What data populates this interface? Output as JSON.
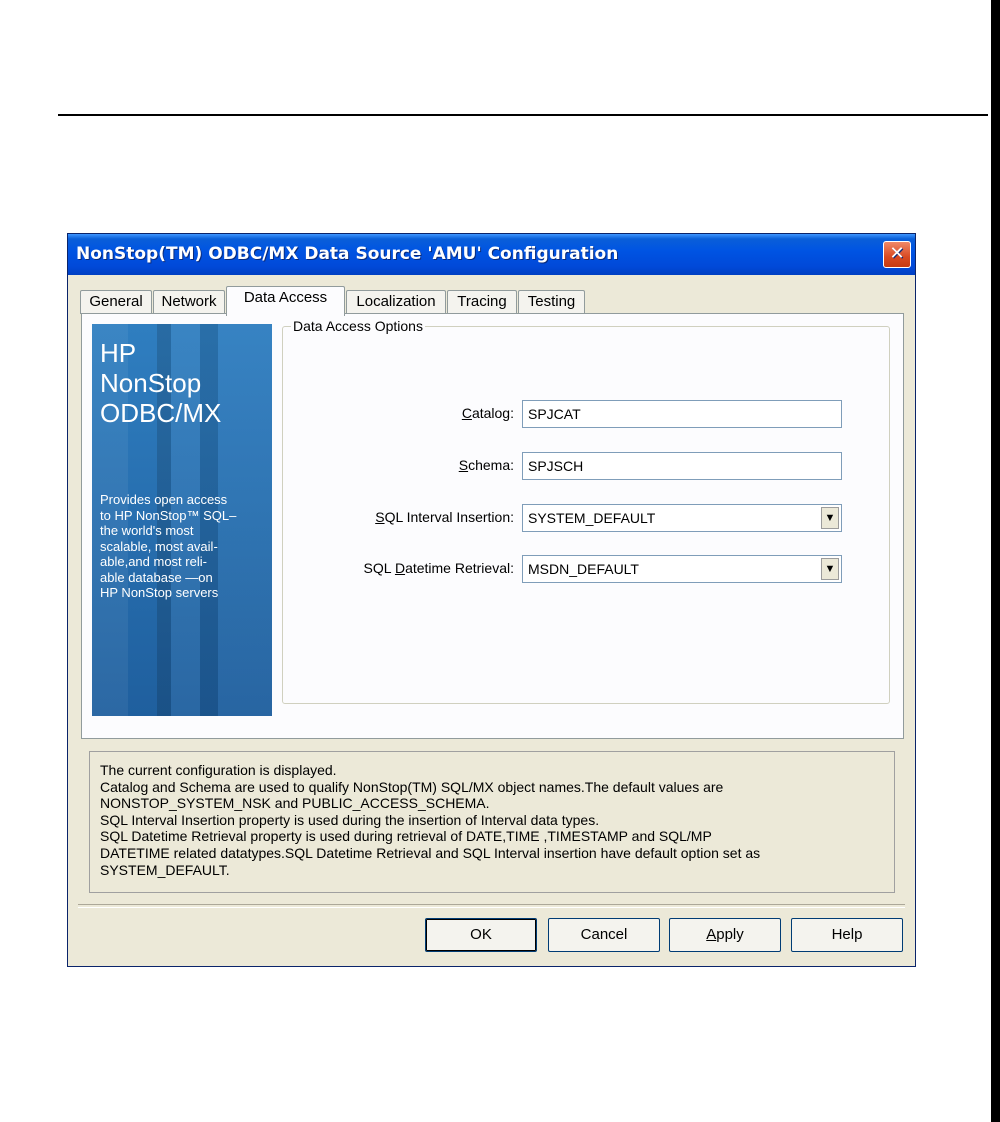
{
  "dialog": {
    "title": "NonStop(TM) ODBC/MX Data Source 'AMU' Configuration",
    "close_glyph": "✕"
  },
  "tabs": [
    {
      "label": "General"
    },
    {
      "label": "Network"
    },
    {
      "label": "Data Access",
      "active": true
    },
    {
      "label": "Localization"
    },
    {
      "label": "Tracing"
    },
    {
      "label": "Testing"
    }
  ],
  "banner": {
    "title": "HP\nNonStop\nODBC/MX",
    "text": "Provides open access\nto HP NonStop™ SQL–\nthe world's most\nscalable, most avail-\nable,and most reli-\nable database —on\nHP NonStop servers"
  },
  "group": {
    "legend": "Data Access Options"
  },
  "fields": {
    "catalog": {
      "label_mnemonic": "C",
      "label_rest": "atalog:",
      "value": "SPJCAT"
    },
    "schema": {
      "label_mnemonic": "S",
      "label_rest": "chema:",
      "value": "SPJSCH"
    },
    "interval": {
      "label_pre": "",
      "label_mnemonic": "S",
      "label_rest": "QL Interval Insertion:",
      "value": "SYSTEM_DEFAULT"
    },
    "datetime": {
      "label_pre": "SQL ",
      "label_mnemonic": "D",
      "label_rest": "atetime Retrieval:",
      "value": "MSDN_DEFAULT"
    }
  },
  "dropdown_arrow": "▼",
  "status": {
    "text": "The current configuration is displayed.\nCatalog and Schema are used to qualify NonStop(TM) SQL/MX object names.The default values are\nNONSTOP_SYSTEM_NSK and PUBLIC_ACCESS_SCHEMA.\nSQL Interval Insertion property is used during the insertion of Interval data types.\nSQL Datetime Retrieval property is used during retrieval of DATE,TIME ,TIMESTAMP and SQL/MP\nDATETIME related datatypes.SQL Datetime Retrieval and SQL Interval insertion have default option set as\nSYSTEM_DEFAULT."
  },
  "buttons": {
    "ok": "OK",
    "cancel": "Cancel",
    "apply_mnemonic": "A",
    "apply_rest": "pply",
    "help": "Help"
  }
}
